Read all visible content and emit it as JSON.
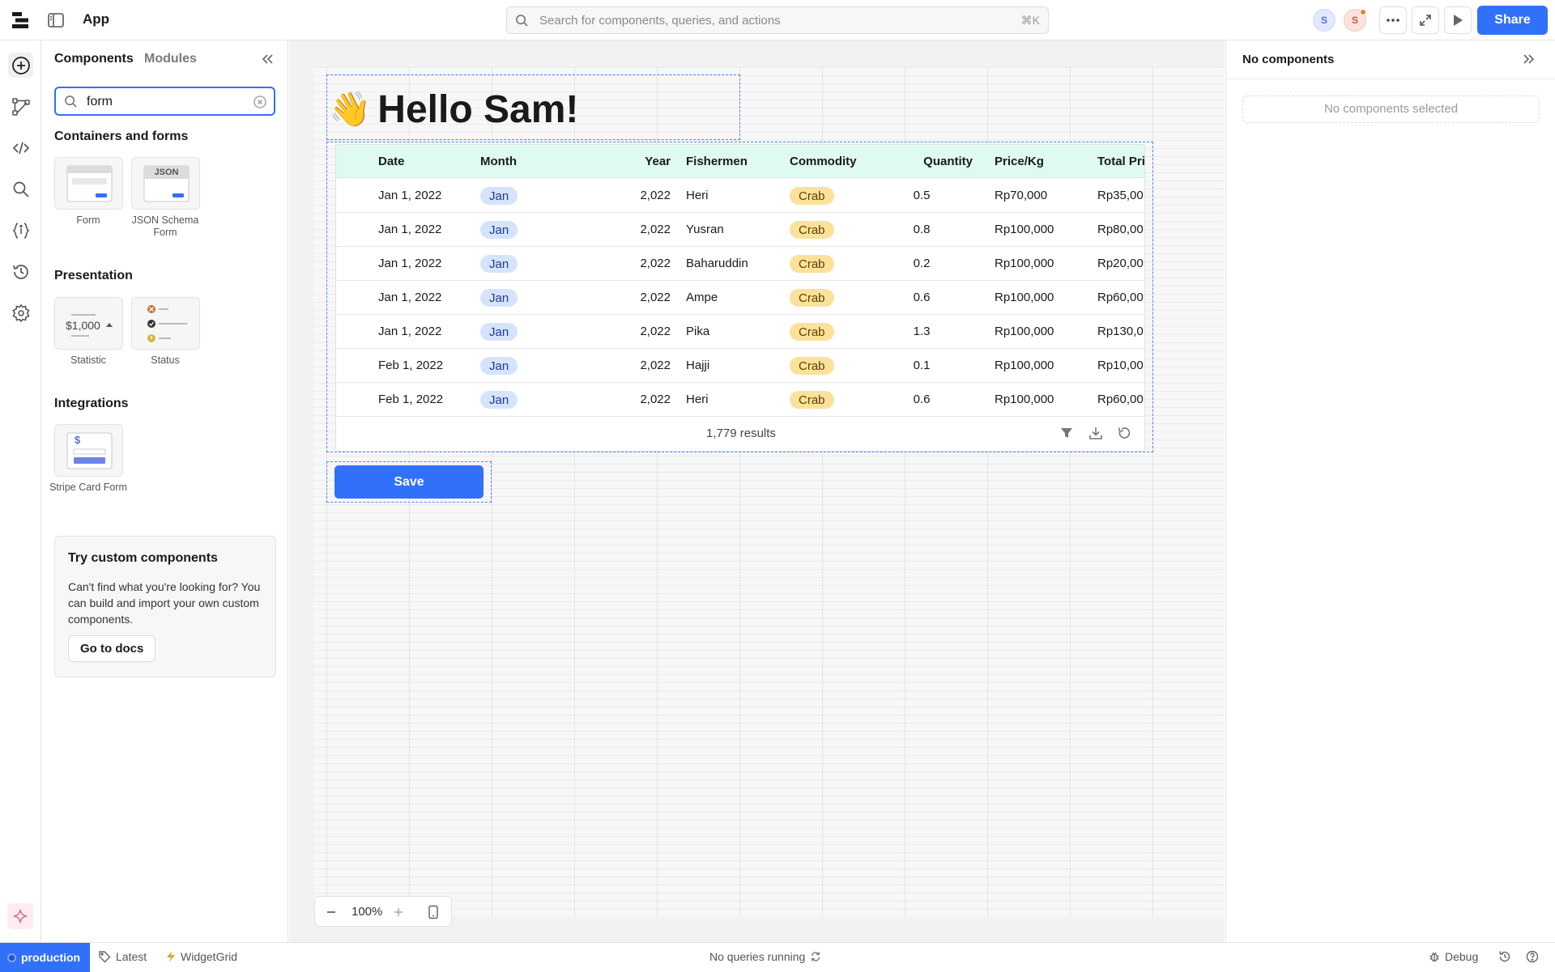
{
  "header": {
    "app_title": "App",
    "search_placeholder": "Search for components, queries, and actions",
    "search_shortcut": "⌘K",
    "avatars": [
      "S",
      "S"
    ],
    "share_label": "Share"
  },
  "left_panel": {
    "tabs": [
      "Components",
      "Modules"
    ],
    "search_value": "form",
    "sections": {
      "containers": {
        "title": "Containers and forms",
        "items": [
          "Form",
          "JSON Schema Form"
        ],
        "json_badge": "JSON"
      },
      "presentation": {
        "title": "Presentation",
        "items": [
          "Statistic",
          "Status"
        ],
        "statistic_preview": "$1,000"
      },
      "integrations": {
        "title": "Integrations",
        "items": [
          "Stripe Card Form"
        ],
        "stripe_symbol": "$"
      }
    },
    "custom_card": {
      "title": "Try custom components",
      "body": "Can't find what you're looking for? You can build and import your own custom components.",
      "button": "Go to docs"
    }
  },
  "canvas": {
    "greeting": "Hello Sam!",
    "greeting_emoji": "👋",
    "table": {
      "columns": [
        "Date",
        "Month",
        "Year",
        "Fishermen",
        "Commodity",
        "Quantity",
        "Price/Kg",
        "Total Pri"
      ],
      "rows": [
        [
          "Jan 1, 2022",
          "Jan",
          "2,022",
          "Heri",
          "Crab",
          "0.5",
          "Rp70,000",
          "Rp35,00"
        ],
        [
          "Jan 1, 2022",
          "Jan",
          "2,022",
          "Yusran",
          "Crab",
          "0.8",
          "Rp100,000",
          "Rp80,00"
        ],
        [
          "Jan 1, 2022",
          "Jan",
          "2,022",
          "Baharuddin",
          "Crab",
          "0.2",
          "Rp100,000",
          "Rp20,00"
        ],
        [
          "Jan 1, 2022",
          "Jan",
          "2,022",
          "Ampe",
          "Crab",
          "0.6",
          "Rp100,000",
          "Rp60,00"
        ],
        [
          "Jan 1, 2022",
          "Jan",
          "2,022",
          "Pika",
          "Crab",
          "1.3",
          "Rp100,000",
          "Rp130,0"
        ],
        [
          "Feb 1, 2022",
          "Jan",
          "2,022",
          "Hajji",
          "Crab",
          "0.1",
          "Rp100,000",
          "Rp10,00"
        ],
        [
          "Feb 1, 2022",
          "Jan",
          "2,022",
          "Heri",
          "Crab",
          "0.6",
          "Rp100,000",
          "Rp60,00"
        ]
      ],
      "results": "1,779 results"
    },
    "save_label": "Save",
    "zoom": "100%"
  },
  "right_panel": {
    "title": "No components",
    "empty": "No components selected"
  },
  "status_bar": {
    "env": "production",
    "tag": "Latest",
    "widget": "WidgetGrid",
    "queries": "No queries running",
    "debug": "Debug"
  },
  "colors": {
    "accent": "#3170f9",
    "header_row": "#dffbf0",
    "pill_blue": "#d6e3fc",
    "pill_yellow": "#fbe19a"
  }
}
